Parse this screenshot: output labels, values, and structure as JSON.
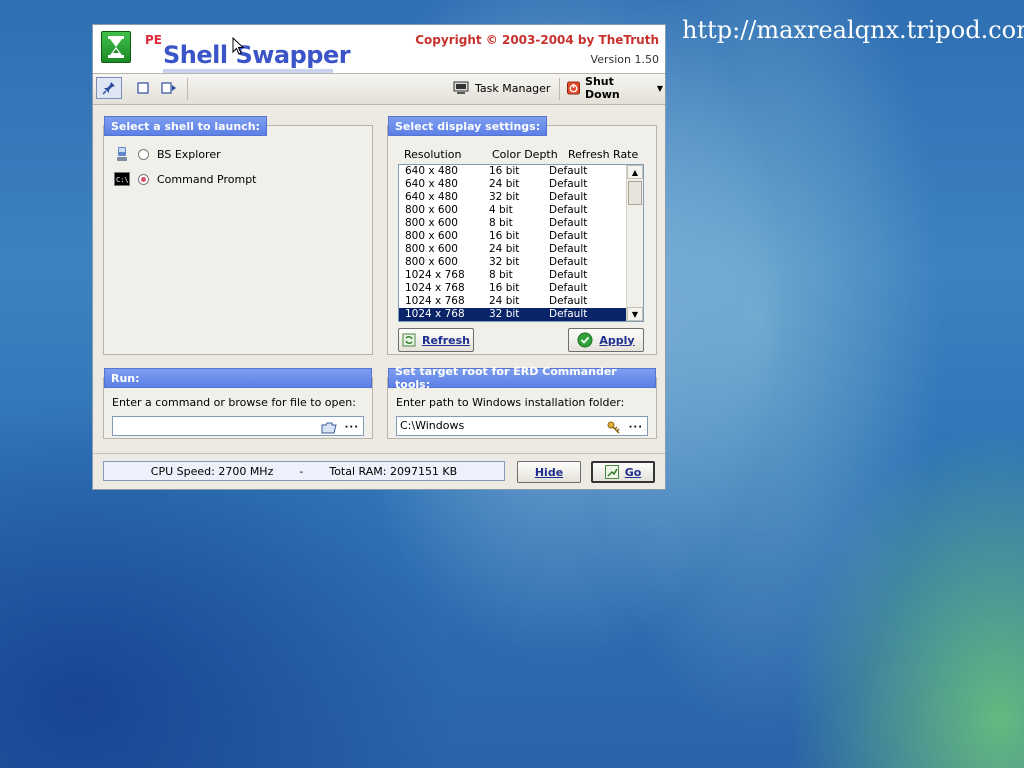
{
  "desktop": {
    "url_text": "http://maxrealqnx.tripod.com"
  },
  "app": {
    "pe_label": "PE",
    "title": "Shell Swapper",
    "copyright": "Copyright © 2003-2004 by TheTruth",
    "version": "Version 1.50"
  },
  "toolbar": {
    "task_manager_label": "Task Manager",
    "shutdown_label": "Shut Down"
  },
  "shell_panel": {
    "title": "Select a shell to launch:",
    "options": [
      {
        "label": "BS Explorer",
        "selected": false
      },
      {
        "label": "Command Prompt",
        "selected": true
      }
    ]
  },
  "display_panel": {
    "title": "Select display settings:",
    "columns": [
      "Resolution",
      "Color Depth",
      "Refresh Rate"
    ],
    "rows": [
      [
        "640 x 480",
        "16 bit",
        "Default"
      ],
      [
        "640 x 480",
        "24 bit",
        "Default"
      ],
      [
        "640 x 480",
        "32 bit",
        "Default"
      ],
      [
        "800 x 600",
        "4 bit",
        "Default"
      ],
      [
        "800 x 600",
        "8 bit",
        "Default"
      ],
      [
        "800 x 600",
        "16 bit",
        "Default"
      ],
      [
        "800 x 600",
        "24 bit",
        "Default"
      ],
      [
        "800 x 600",
        "32 bit",
        "Default"
      ],
      [
        "1024 x 768",
        "8 bit",
        "Default"
      ],
      [
        "1024 x 768",
        "16 bit",
        "Default"
      ],
      [
        "1024 x 768",
        "24 bit",
        "Default"
      ],
      [
        "1024 x 768",
        "32 bit",
        "Default"
      ]
    ],
    "selected_index": 11,
    "refresh_label": "Refresh",
    "apply_label": "Apply"
  },
  "run_panel": {
    "title": "Run:",
    "prompt": "Enter a command or browse for file to open:",
    "value": ""
  },
  "erd_panel": {
    "title": "Set target root for ERD Commander tools:",
    "prompt": "Enter path to Windows installation folder:",
    "value": "C:\\Windows"
  },
  "status": {
    "cpu": "CPU Speed: 2700 MHz",
    "separator": "-",
    "ram": "Total RAM: 2097151 KB"
  },
  "footer": {
    "hide_label": "Hide",
    "go_label": "Go"
  },
  "colors": {
    "accent": "#5b7fe6",
    "title_blue": "#3b55c8",
    "copyright_red": "#c8322e",
    "selection": "#0a246a"
  }
}
